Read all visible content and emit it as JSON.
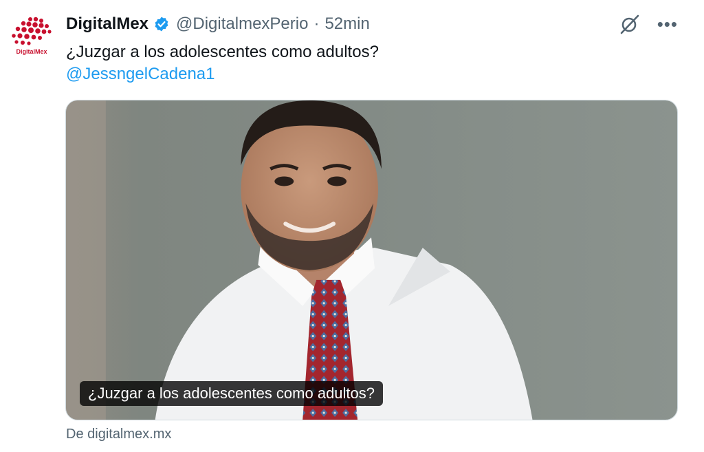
{
  "tweet": {
    "author_name": "DigitalMex",
    "author_handle": "@DigitalmexPerio",
    "separator": "·",
    "timestamp": "52min",
    "text": "¿Juzgar a los adolescentes como adultos?",
    "mention": "@JessngelCadena1",
    "avatar_brand_text": "DigitalMex",
    "icons": {
      "verified": "verified-badge-icon",
      "grok": "grok-icon",
      "more": "more-options-icon"
    }
  },
  "card": {
    "title": "¿Juzgar a los adolescentes como adultos?",
    "source": "De digitalmex.mx",
    "image_alt": "Portrait of a smiling man in a white shirt and patterned red tie"
  },
  "colors": {
    "accent": "#1d9bf0",
    "secondary_text": "#536471",
    "brand_red": "#c8102e"
  }
}
